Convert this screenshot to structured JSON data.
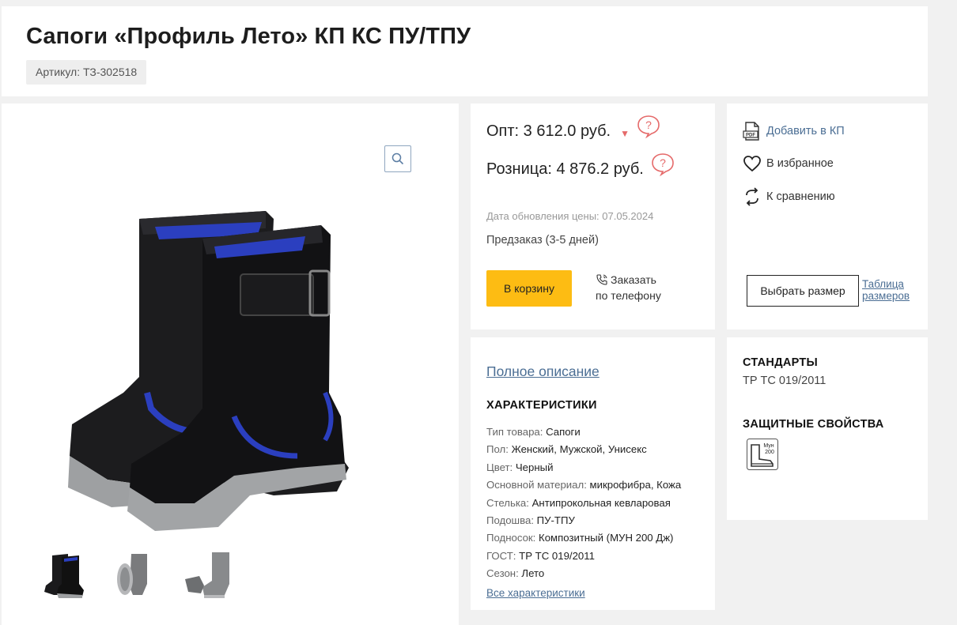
{
  "product": {
    "title": "Сапоги «Профиль Лето» КП КС ПУ/ТПУ",
    "sku": "Артикул: ТЗ-302518"
  },
  "gallery": {
    "zoom_icon": "magnifier-icon",
    "main_image": "black-leather-boots-photo",
    "thumbnails": [
      "boots-front-thumb",
      "boot-sole-thumb",
      "boot-side-thumb"
    ]
  },
  "pricing": {
    "wholesale": "Опт: 3 612.0 руб.",
    "retail": "Розница: 4 876.2 руб.",
    "updated": "Дата обновления цены: 07.05.2024",
    "availability": "Предзаказ (3-5 дней)",
    "cart_button": "В корзину",
    "phone_order_line1": "Заказать",
    "phone_order_line2": "по телефону"
  },
  "actions": {
    "add_kp": "Добавить в КП",
    "favorite": "В избранное",
    "compare": "К сравнению",
    "choose_size": "Выбрать размер",
    "size_table_line1": "Таблица",
    "size_table_line2": "размеров"
  },
  "description": {
    "full_link": "Полное описание",
    "heading": "ХАРАКТЕРИСТИКИ",
    "items": [
      {
        "key": "Тип товара:",
        "value": "Сапоги"
      },
      {
        "key": "Пол:",
        "value": "Женский, Мужской, Унисекс"
      },
      {
        "key": "Цвет:",
        "value": "Черный"
      },
      {
        "key": "Основной материал:",
        "value": "микрофибра, Кожа"
      },
      {
        "key": "Стелька:",
        "value": "Антипрокольная кевларовая"
      },
      {
        "key": "Подошва:",
        "value": "ПУ-ТПУ"
      },
      {
        "key": "Подносок:",
        "value": "Композитный (МУН 200 Дж)"
      },
      {
        "key": "ГОСТ:",
        "value": "ТР ТС 019/2011"
      },
      {
        "key": "Сезон:",
        "value": "Лето"
      }
    ],
    "all_link": "Все характеристики"
  },
  "standards": {
    "heading": "СТАНДАРТЫ",
    "value": "ТР ТС 019/2011",
    "protection_heading": "ЗАЩИТНЫЕ СВОЙСТВА",
    "protection_icon_label_1": "Мун",
    "protection_icon_label_2": "200"
  },
  "colors": {
    "accent_yellow": "#fdbc13",
    "link_blue": "#4b6e94",
    "price_question_red": "#e56a6a"
  }
}
